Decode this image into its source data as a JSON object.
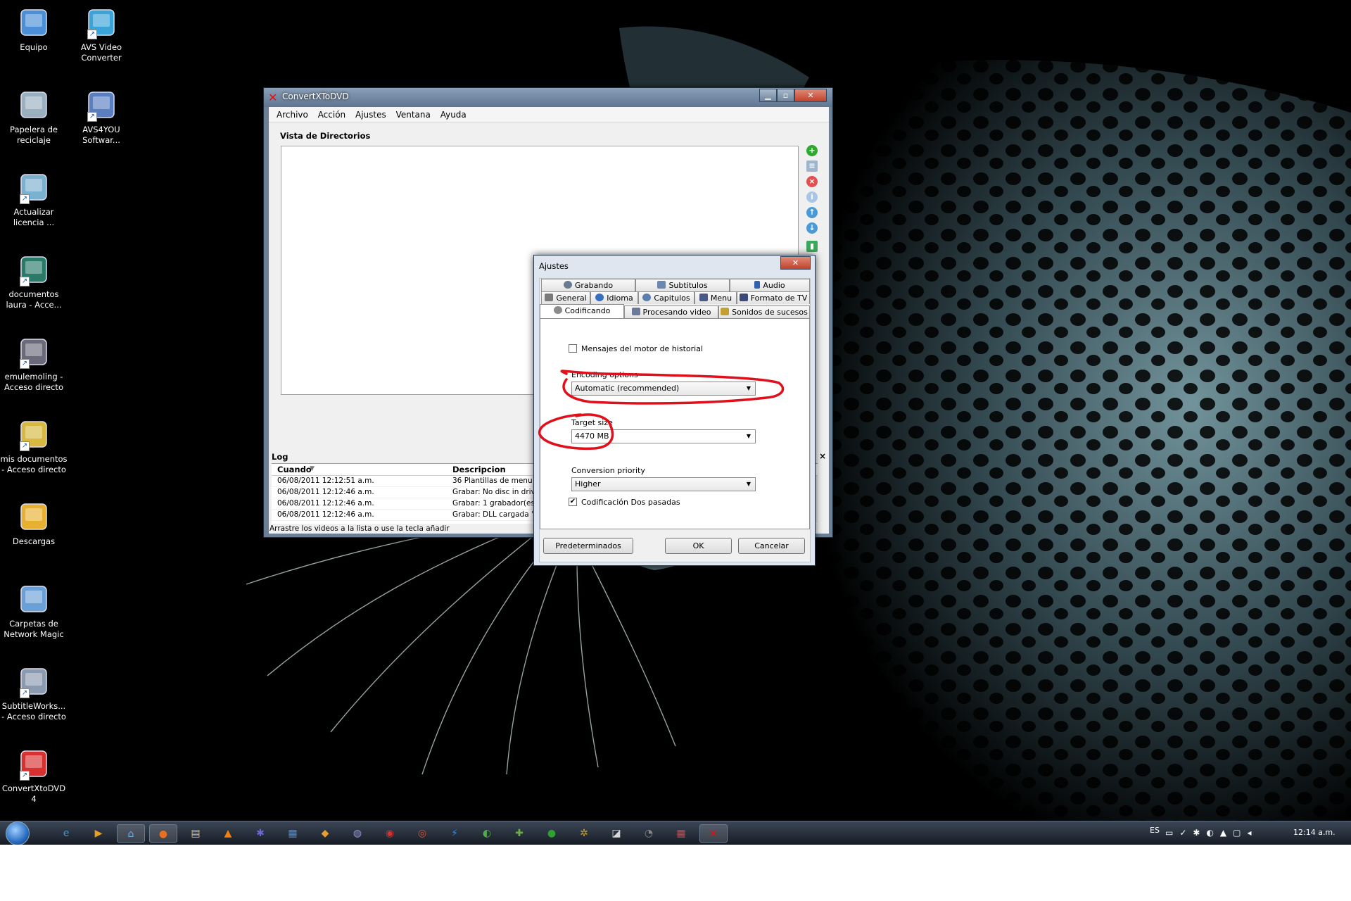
{
  "desktop": {
    "icons": [
      {
        "label": "Equipo",
        "icon": "computer-icon",
        "shortcut": false
      },
      {
        "label": "AVS Video Converter",
        "icon": "avs-video-converter-icon",
        "shortcut": true
      },
      {
        "label": "Papelera de reciclaje",
        "icon": "recycle-bin-icon",
        "shortcut": false
      },
      {
        "label": "AVS4YOU Softwar...",
        "icon": "avs4you-icon",
        "shortcut": true
      },
      {
        "label": "Actualizar licencia ...",
        "icon": "license-update-icon",
        "shortcut": true
      },
      {
        "label": "documentos laura - Acce...",
        "icon": "folder-shortcut-icon",
        "shortcut": true
      },
      {
        "label": "emulemoling - Acceso directo",
        "icon": "emule-icon",
        "shortcut": true
      },
      {
        "label": "mis documentos - Acceso directo",
        "icon": "documents-folder-icon",
        "shortcut": true
      },
      {
        "label": "Descargas",
        "icon": "downloads-folder-icon",
        "shortcut": false
      },
      {
        "label": "Carpetas de Network Magic",
        "icon": "network-magic-folder-icon",
        "shortcut": false
      },
      {
        "label": "SubtitleWorks... - Acceso directo",
        "icon": "subtitleworkshop-icon",
        "shortcut": true
      },
      {
        "label": "ConvertXtoDVD 4",
        "icon": "convertxtodvd-icon",
        "shortcut": true
      }
    ]
  },
  "main_window": {
    "title": "ConvertXToDVD",
    "menu": [
      "Archivo",
      "Acción",
      "Ajustes",
      "Ventana",
      "Ayuda"
    ],
    "dir_view_title": "Vista de Directorios",
    "side_buttons": [
      "add-icon",
      "reorder-icon",
      "remove-icon",
      "info-icon",
      "move-up-icon",
      "move-down-icon",
      "convert-icon"
    ],
    "log": {
      "title": "Log",
      "columns": [
        "Cuando",
        "Descripcion"
      ],
      "rows": [
        {
          "when": "06/08/2011 12:12:51 a.m.",
          "desc": "36 Plantillas de menu car"
        },
        {
          "when": "06/08/2011 12:12:46 a.m.",
          "desc": "Grabar:  No disc in drive."
        },
        {
          "when": "06/08/2011 12:12:46 a.m.",
          "desc": "Grabar:  1 grabador(es) e"
        },
        {
          "when": "06/08/2011 12:12:46 a.m.",
          "desc": "Grabar: DLL cargada \"C:"
        }
      ]
    },
    "status": "Arrastre los videos a la lista o use la tecla añadir"
  },
  "settings_dialog": {
    "title": "Ajustes",
    "tabs_row1": [
      "Grabando",
      "Subtitulos",
      "Audio"
    ],
    "tabs_row2": [
      "General",
      "Idioma",
      "Capitulos",
      "Menu",
      "Formato de TV"
    ],
    "tabs_row3": [
      "Codificando",
      "Procesando video",
      "Sonidos de sucesos"
    ],
    "active_tab": "Codificando",
    "history_msgs_label": "Mensajes del motor de historial",
    "history_msgs_checked": false,
    "encoding_options_label": "Encoding options",
    "encoding_options_value": "Automatic (recommended)",
    "target_size_label": "Target size",
    "target_size_value": "4470 MB",
    "conversion_priority_label": "Conversion priority",
    "conversion_priority_value": "Higher",
    "two_pass_label": "Codificación Dos pasadas",
    "two_pass_checked": true,
    "buttons": {
      "defaults": "Predeterminados",
      "ok": "OK",
      "cancel": "Cancelar"
    },
    "highlight_color": "#e0101a"
  },
  "taskbar": {
    "language": "ES",
    "clock": "12:14 a.m."
  }
}
